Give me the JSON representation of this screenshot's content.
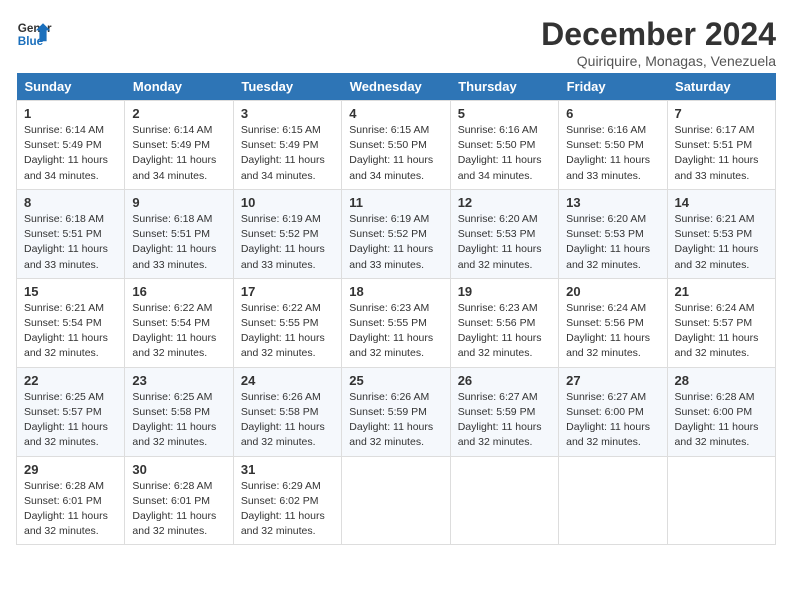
{
  "logo": {
    "line1": "General",
    "line2": "Blue"
  },
  "title": "December 2024",
  "subtitle": "Quiriquire, Monagas, Venezuela",
  "days_of_week": [
    "Sunday",
    "Monday",
    "Tuesday",
    "Wednesday",
    "Thursday",
    "Friday",
    "Saturday"
  ],
  "weeks": [
    [
      {
        "day": "1",
        "text": "Sunrise: 6:14 AM\nSunset: 5:49 PM\nDaylight: 11 hours and 34 minutes."
      },
      {
        "day": "2",
        "text": "Sunrise: 6:14 AM\nSunset: 5:49 PM\nDaylight: 11 hours and 34 minutes."
      },
      {
        "day": "3",
        "text": "Sunrise: 6:15 AM\nSunset: 5:49 PM\nDaylight: 11 hours and 34 minutes."
      },
      {
        "day": "4",
        "text": "Sunrise: 6:15 AM\nSunset: 5:50 PM\nDaylight: 11 hours and 34 minutes."
      },
      {
        "day": "5",
        "text": "Sunrise: 6:16 AM\nSunset: 5:50 PM\nDaylight: 11 hours and 34 minutes."
      },
      {
        "day": "6",
        "text": "Sunrise: 6:16 AM\nSunset: 5:50 PM\nDaylight: 11 hours and 33 minutes."
      },
      {
        "day": "7",
        "text": "Sunrise: 6:17 AM\nSunset: 5:51 PM\nDaylight: 11 hours and 33 minutes."
      }
    ],
    [
      {
        "day": "8",
        "text": "Sunrise: 6:18 AM\nSunset: 5:51 PM\nDaylight: 11 hours and 33 minutes."
      },
      {
        "day": "9",
        "text": "Sunrise: 6:18 AM\nSunset: 5:51 PM\nDaylight: 11 hours and 33 minutes."
      },
      {
        "day": "10",
        "text": "Sunrise: 6:19 AM\nSunset: 5:52 PM\nDaylight: 11 hours and 33 minutes."
      },
      {
        "day": "11",
        "text": "Sunrise: 6:19 AM\nSunset: 5:52 PM\nDaylight: 11 hours and 33 minutes."
      },
      {
        "day": "12",
        "text": "Sunrise: 6:20 AM\nSunset: 5:53 PM\nDaylight: 11 hours and 32 minutes."
      },
      {
        "day": "13",
        "text": "Sunrise: 6:20 AM\nSunset: 5:53 PM\nDaylight: 11 hours and 32 minutes."
      },
      {
        "day": "14",
        "text": "Sunrise: 6:21 AM\nSunset: 5:53 PM\nDaylight: 11 hours and 32 minutes."
      }
    ],
    [
      {
        "day": "15",
        "text": "Sunrise: 6:21 AM\nSunset: 5:54 PM\nDaylight: 11 hours and 32 minutes."
      },
      {
        "day": "16",
        "text": "Sunrise: 6:22 AM\nSunset: 5:54 PM\nDaylight: 11 hours and 32 minutes."
      },
      {
        "day": "17",
        "text": "Sunrise: 6:22 AM\nSunset: 5:55 PM\nDaylight: 11 hours and 32 minutes."
      },
      {
        "day": "18",
        "text": "Sunrise: 6:23 AM\nSunset: 5:55 PM\nDaylight: 11 hours and 32 minutes."
      },
      {
        "day": "19",
        "text": "Sunrise: 6:23 AM\nSunset: 5:56 PM\nDaylight: 11 hours and 32 minutes."
      },
      {
        "day": "20",
        "text": "Sunrise: 6:24 AM\nSunset: 5:56 PM\nDaylight: 11 hours and 32 minutes."
      },
      {
        "day": "21",
        "text": "Sunrise: 6:24 AM\nSunset: 5:57 PM\nDaylight: 11 hours and 32 minutes."
      }
    ],
    [
      {
        "day": "22",
        "text": "Sunrise: 6:25 AM\nSunset: 5:57 PM\nDaylight: 11 hours and 32 minutes."
      },
      {
        "day": "23",
        "text": "Sunrise: 6:25 AM\nSunset: 5:58 PM\nDaylight: 11 hours and 32 minutes."
      },
      {
        "day": "24",
        "text": "Sunrise: 6:26 AM\nSunset: 5:58 PM\nDaylight: 11 hours and 32 minutes."
      },
      {
        "day": "25",
        "text": "Sunrise: 6:26 AM\nSunset: 5:59 PM\nDaylight: 11 hours and 32 minutes."
      },
      {
        "day": "26",
        "text": "Sunrise: 6:27 AM\nSunset: 5:59 PM\nDaylight: 11 hours and 32 minutes."
      },
      {
        "day": "27",
        "text": "Sunrise: 6:27 AM\nSunset: 6:00 PM\nDaylight: 11 hours and 32 minutes."
      },
      {
        "day": "28",
        "text": "Sunrise: 6:28 AM\nSunset: 6:00 PM\nDaylight: 11 hours and 32 minutes."
      }
    ],
    [
      {
        "day": "29",
        "text": "Sunrise: 6:28 AM\nSunset: 6:01 PM\nDaylight: 11 hours and 32 minutes."
      },
      {
        "day": "30",
        "text": "Sunrise: 6:28 AM\nSunset: 6:01 PM\nDaylight: 11 hours and 32 minutes."
      },
      {
        "day": "31",
        "text": "Sunrise: 6:29 AM\nSunset: 6:02 PM\nDaylight: 11 hours and 32 minutes."
      },
      {
        "day": "",
        "text": ""
      },
      {
        "day": "",
        "text": ""
      },
      {
        "day": "",
        "text": ""
      },
      {
        "day": "",
        "text": ""
      }
    ]
  ]
}
